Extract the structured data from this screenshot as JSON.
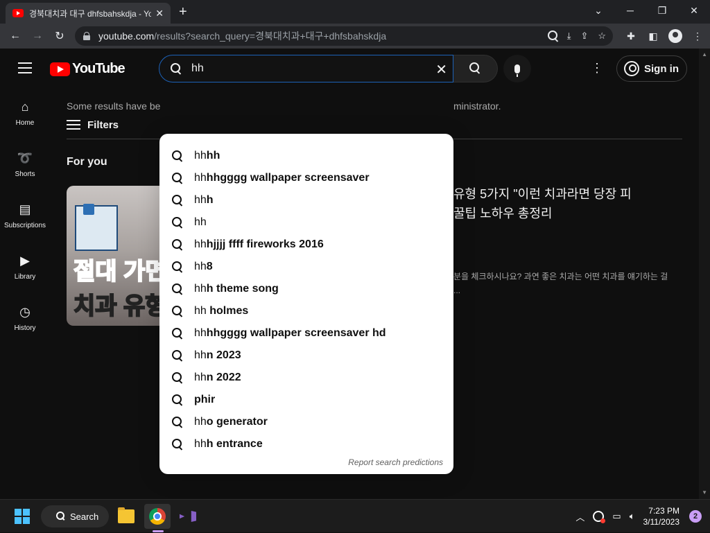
{
  "browser": {
    "tab_title": "경북대치과 대구 dhfsbahskdja - YouTube",
    "url_host": "youtube.com",
    "url_path": "/results?search_query=경북대치과+대구+dhfsbahskdja"
  },
  "masthead": {
    "logo_text": "YouTube",
    "search_value": "hh",
    "signin_label": "Sign in"
  },
  "guide": {
    "items": [
      {
        "label": "Home",
        "icon": "home-icon"
      },
      {
        "label": "Shorts",
        "icon": "shorts-icon"
      },
      {
        "label": "Subscriptions",
        "icon": "subscriptions-icon"
      },
      {
        "label": "Library",
        "icon": "library-icon"
      },
      {
        "label": "History",
        "icon": "history-icon"
      }
    ]
  },
  "results": {
    "notice_left": "Some results have be",
    "notice_right": "ministrator.",
    "filters_label": "Filters",
    "section_title": "For you",
    "thumb_text_1": "절대 가면",
    "thumb_text_2": "치과 유형",
    "video_title_1": "유형 5가지 \"이런 치과라면 당장 피",
    "video_title_2": " 꿀팁 노하우 총정리",
    "video_desc_1": "분을 체크하시나요? 과연 좋은 치과는 어떤 치과를 얘기하는 걸",
    "video_desc_2": "..."
  },
  "suggestions": {
    "items": [
      {
        "prefix": "hh",
        "rest": "hh"
      },
      {
        "prefix": "hh",
        "rest": "hhgggg wallpaper screensaver"
      },
      {
        "prefix": "hh",
        "rest": "h"
      },
      {
        "prefix": "hh",
        "rest": ""
      },
      {
        "prefix": "hh",
        "rest": "hjjjj ffff fireworks 2016"
      },
      {
        "prefix": "hh",
        "rest": "8"
      },
      {
        "prefix": "hh",
        "rest": "h theme song"
      },
      {
        "prefix": "hh",
        "rest": " holmes"
      },
      {
        "prefix": "hh",
        "rest": "hhgggg wallpaper screensaver hd"
      },
      {
        "prefix": "hh",
        "rest": "n 2023"
      },
      {
        "prefix": "hh",
        "rest": "n 2022"
      },
      {
        "prefix": "",
        "rest": "phir"
      },
      {
        "prefix": "hh",
        "rest": "o generator"
      },
      {
        "prefix": "hh",
        "rest": "h entrance"
      }
    ],
    "report_label": "Report search predictions"
  },
  "taskbar": {
    "search_label": "Search",
    "time": "7:23 PM",
    "date": "3/11/2023",
    "notification_count": "2"
  },
  "colors": {
    "accent_blue": "#1c62b9",
    "youtube_red": "#ff0000",
    "background": "#0f0f0f"
  }
}
